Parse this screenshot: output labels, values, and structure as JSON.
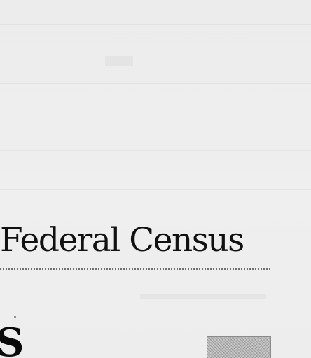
{
  "section": {
    "heading": "Federal Census",
    "partial_next_heading": "S"
  }
}
